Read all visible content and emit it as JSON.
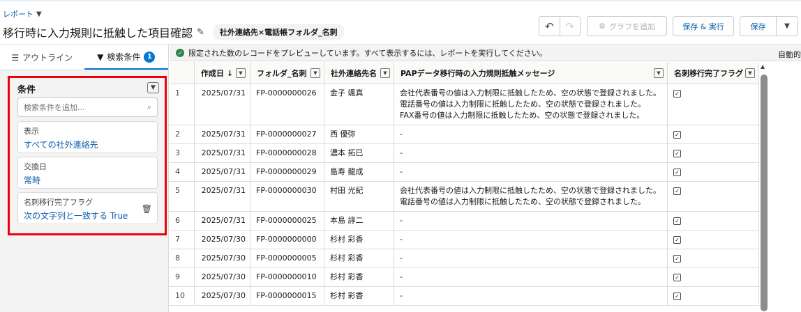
{
  "header": {
    "breadcrumb": "レポート",
    "title": "移行時に入力規則に抵触した項目確認",
    "report_type": "社外連絡先×電話帳フォルダ_名刺",
    "add_chart_label": "グラフを追加",
    "save_run_label": "保存 & 実行",
    "save_label": "保存"
  },
  "sidebar": {
    "tab_outline": "アウトライン",
    "tab_filters": "検索条件",
    "filter_count": "1",
    "conditions_heading": "条件",
    "search_placeholder": "検索条件を追加...",
    "filters": [
      {
        "label": "表示",
        "value": "すべての社外連絡先"
      },
      {
        "label": "交換日",
        "value": "常時"
      },
      {
        "label": "名刺移行完了フラグ",
        "value": "次の文字列と一致する True"
      }
    ]
  },
  "main": {
    "notice": "限定された数のレコードをプレビューしています。すべて表示するには、レポートを実行してください。",
    "auto_label": "自動的",
    "columns": [
      "作成日 ↓",
      "フォルダ_名刺",
      "社外連絡先名",
      "PAPデータ移行時の入力規則抵触メッセージ",
      "名刺移行完了フラグ"
    ],
    "rows": [
      {
        "n": "1",
        "date": "2025/07/31",
        "folder": "FP-0000000026",
        "name": "金子 颯真",
        "msg": [
          "会社代表番号の値は入力制限に抵触したため、空の状態で登録されました。",
          "電話番号の値は入力制限に抵触したため、空の状態で登録されました。",
          "FAX番号の値は入力制限に抵触したため、空の状態で登録されました。"
        ]
      },
      {
        "n": "2",
        "date": "2025/07/31",
        "folder": "FP-0000000027",
        "name": "西 優弥",
        "msg": [
          "-"
        ]
      },
      {
        "n": "3",
        "date": "2025/07/31",
        "folder": "FP-0000000028",
        "name": "濃本 拓巳",
        "msg": [
          "-"
        ]
      },
      {
        "n": "4",
        "date": "2025/07/31",
        "folder": "FP-0000000029",
        "name": "島寿 龍成",
        "msg": [
          "-"
        ]
      },
      {
        "n": "5",
        "date": "2025/07/31",
        "folder": "FP-0000000030",
        "name": "村田 光紀",
        "msg": [
          "会社代表番号の値は入力制限に抵触したため、空の状態で登録されました。",
          "電話番号の値は入力制限に抵触したため、空の状態で登録されました。"
        ]
      },
      {
        "n": "6",
        "date": "2025/07/31",
        "folder": "FP-0000000025",
        "name": "本島 諄二",
        "msg": [
          "-"
        ]
      },
      {
        "n": "7",
        "date": "2025/07/30",
        "folder": "FP-0000000000",
        "name": "杉村 彩香",
        "msg": [
          "-"
        ]
      },
      {
        "n": "8",
        "date": "2025/07/30",
        "folder": "FP-0000000005",
        "name": "杉村 彩香",
        "msg": [
          "-"
        ]
      },
      {
        "n": "9",
        "date": "2025/07/30",
        "folder": "FP-0000000010",
        "name": "杉村 彩香",
        "msg": [
          "-"
        ]
      },
      {
        "n": "10",
        "date": "2025/07/30",
        "folder": "FP-0000000015",
        "name": "杉村 彩香",
        "msg": [
          "-"
        ]
      }
    ]
  }
}
